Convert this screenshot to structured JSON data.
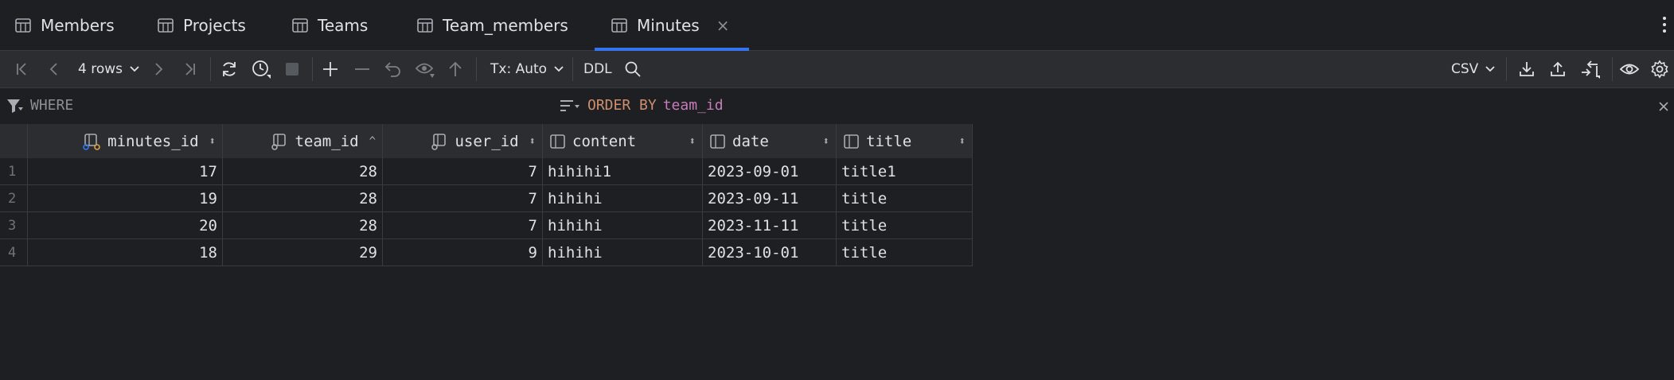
{
  "tabs": [
    {
      "label": "Members"
    },
    {
      "label": "Projects"
    },
    {
      "label": "Teams"
    },
    {
      "label": "Team_members"
    },
    {
      "label": "Minutes",
      "close": "×"
    }
  ],
  "toolbar": {
    "rows_label": "4 rows",
    "tx_label": "Tx: Auto",
    "ddl_label": "DDL",
    "export_format": "CSV"
  },
  "filter": {
    "where_label": "WHERE",
    "order_keyword": "ORDER BY",
    "order_column": "team_id"
  },
  "table": {
    "columns": [
      {
        "label": "minutes_id",
        "sort": "⬍"
      },
      {
        "label": "team_id",
        "sort": "^"
      },
      {
        "label": "user_id",
        "sort": "⬍"
      },
      {
        "label": "content",
        "sort": "⬍"
      },
      {
        "label": "date",
        "sort": "⬍"
      },
      {
        "label": "title",
        "sort": "⬍"
      }
    ],
    "rows": [
      {
        "n": "1",
        "c": [
          "17",
          "28",
          "7",
          "hihihi1",
          "2023-09-01",
          "title1"
        ]
      },
      {
        "n": "2",
        "c": [
          "19",
          "28",
          "7",
          "hihihi",
          "2023-09-11",
          "title"
        ]
      },
      {
        "n": "3",
        "c": [
          "20",
          "28",
          "7",
          "hihihi",
          "2023-11-11",
          "title"
        ]
      },
      {
        "n": "4",
        "c": [
          "18",
          "29",
          "9",
          "hihihi",
          "2023-10-01",
          "title"
        ]
      }
    ]
  },
  "colors": {
    "accent": "#3574f0",
    "keyword": "#cf8e6d",
    "column": "#c77dbb",
    "background": "#1e1f22"
  }
}
